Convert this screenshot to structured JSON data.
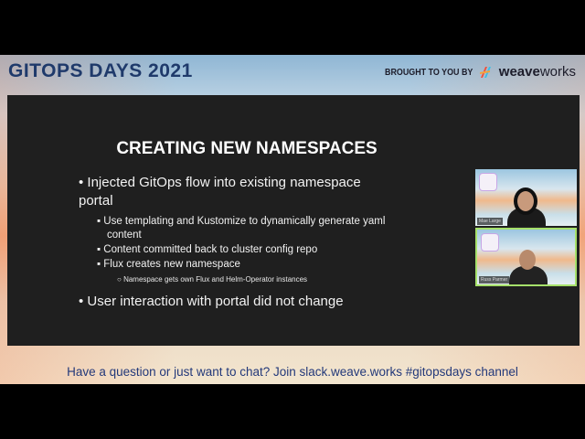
{
  "header": {
    "event_title": "GITOPS DAYS 2021",
    "sponsor_text": "BROUGHT TO YOU BY",
    "brand_bold": "weave",
    "brand_light": "works"
  },
  "slide": {
    "title": "CREATING NEW NAMESPACES",
    "bullets": [
      {
        "text": "Injected GitOps flow into existing namespace portal"
      },
      {
        "text": "Use templating and Kustomize to dynamically generate yaml content"
      },
      {
        "text": "Content committed back to cluster config repo"
      },
      {
        "text": "Flux creates new namespace"
      },
      {
        "text": "Namespace gets own Flux and Helm-Operator instances"
      },
      {
        "text": "User interaction with portal did not change"
      }
    ]
  },
  "participants": [
    {
      "name": "Mae Large",
      "active": false
    },
    {
      "name": "Russ Parmer",
      "active": true
    }
  ],
  "footer": {
    "text": "Have a question or just want to chat? Join slack.weave.works #gitopsdays channel"
  },
  "colors": {
    "title_blue": "#1f3a6b",
    "slide_bg": "#1f1f1f",
    "active_speaker": "#a6e06a",
    "footer_text": "#23397a"
  }
}
